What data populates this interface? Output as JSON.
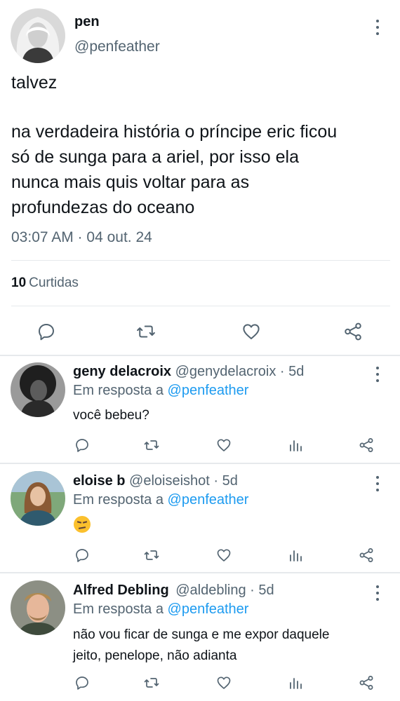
{
  "tweet": {
    "name": "pen",
    "handle": "@penfeather",
    "text_line1": "talvez",
    "text_body": "na verdadeira história o príncipe eric ficou\nsó de sunga para a ariel, por isso ela\nnunca mais quis voltar para as\nprofundezas do oceano",
    "timestamp": "03:07 AM · 04 out. 24",
    "likes_count": "10",
    "likes_label": "Curtidas",
    "actions": [
      "reply-icon",
      "retweet-icon",
      "heart-icon",
      "share-icon"
    ]
  },
  "replies": [
    {
      "name": "geny delacroix",
      "meta": "@genydelacroix · 5d",
      "reply_prefix": "Em resposta a",
      "reply_to": "@penfeather",
      "text": "você bebeu?"
    },
    {
      "name": "eloise b",
      "meta": "@eloiseishot · 5d",
      "reply_prefix": "Em resposta a",
      "reply_to": "@penfeather",
      "emoji": "smirking-face"
    },
    {
      "name": "Alfred Debling",
      "meta": "@aldebling · 5d",
      "reply_prefix": "Em resposta a",
      "reply_to": "@penfeather",
      "text": "não vou ficar de sunga e me expor daquele\njeito, penelope, não adianta"
    }
  ],
  "colors": {
    "text": "#0f1419",
    "secondary": "#536471",
    "link": "#1d9bf0",
    "divider": "#e6e9ec"
  }
}
